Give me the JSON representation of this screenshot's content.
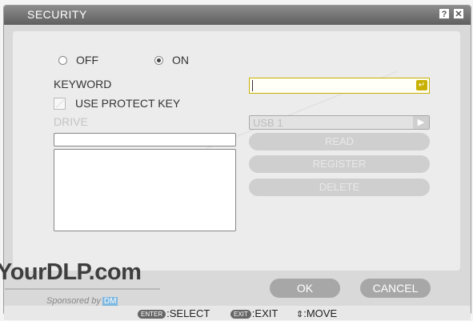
{
  "window": {
    "title": "SECURITY",
    "help_icon": "?",
    "close_icon": "✕"
  },
  "security": {
    "off_label": "OFF",
    "on_label": "ON",
    "selected": "ON",
    "keyword_label": "KEYWORD",
    "keyword_value": "",
    "enter_icon": "↵",
    "use_protect_key_label": "USE PROTECT KEY",
    "drive_label": "DRIVE",
    "drive_select_value": "USB 1",
    "drive_arrow": "▶",
    "read_label": "READ",
    "register_label": "REGISTER",
    "delete_label": "DELETE"
  },
  "footer": {
    "ok_label": "OK",
    "cancel_label": "CANCEL"
  },
  "statusbar": {
    "enter_key": "ENTER",
    "select_text": ":SELECT",
    "exit_key": "EXIT",
    "exit_text": ":EXIT",
    "move_icon": "⇕",
    "move_text": ":MOVE"
  },
  "watermark": {
    "site": "YourDLP.com",
    "sponsored": "Sponsored by",
    "sponsor_logo": "DM"
  }
}
